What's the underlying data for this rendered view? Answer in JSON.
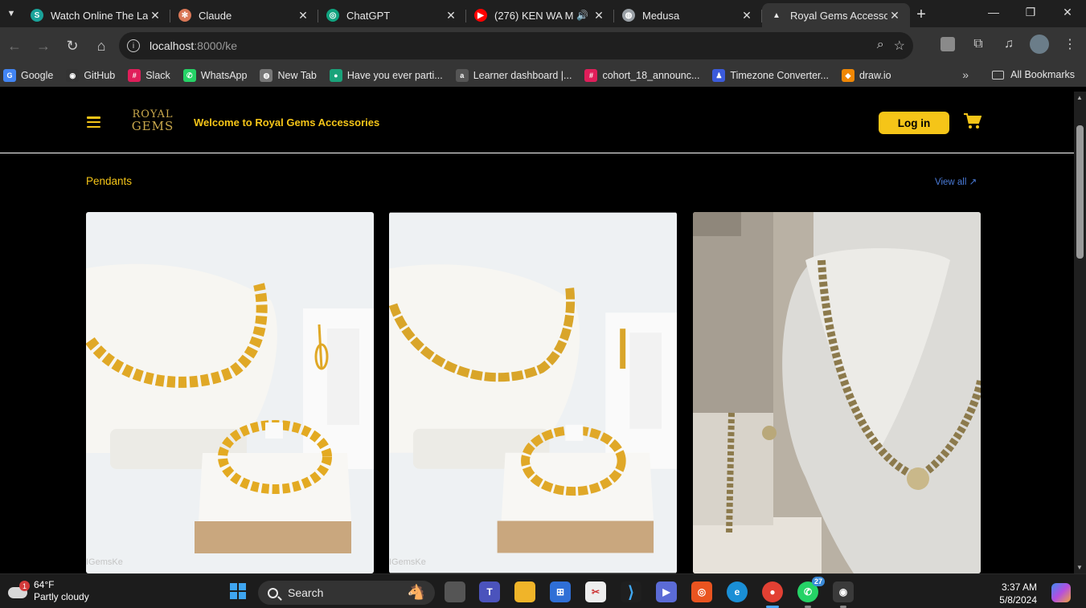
{
  "browser": {
    "tabs": [
      {
        "title": "Watch Online The Las",
        "favicon_color": "#1aa39a",
        "favicon_glyph": "S",
        "active": false
      },
      {
        "title": "Claude",
        "favicon_color": "#d97757",
        "favicon_glyph": "✻",
        "active": false
      },
      {
        "title": "ChatGPT",
        "favicon_color": "#10a37f",
        "favicon_glyph": "◎",
        "active": false
      },
      {
        "title": "(276) KEN WA M",
        "favicon_color": "#ff0000",
        "favicon_glyph": "▶",
        "active": false,
        "audio": true
      },
      {
        "title": "Medusa",
        "favicon_color": "#9aa0a6",
        "favicon_glyph": "◍",
        "active": false
      },
      {
        "title": "Royal Gems Accesso",
        "favicon_color": "#e8e8e8",
        "favicon_glyph": "▲",
        "active": true
      }
    ],
    "url_host": "localhost",
    "url_path": ":8000/ke",
    "bookmarks": [
      {
        "label": "Google",
        "icon_color": "#4285f4",
        "glyph": "G"
      },
      {
        "label": "GitHub",
        "icon_color": "#333333",
        "glyph": "◉"
      },
      {
        "label": "Slack",
        "icon_color": "#e01e5a",
        "glyph": "#"
      },
      {
        "label": "WhatsApp",
        "icon_color": "#25d366",
        "glyph": "✆"
      },
      {
        "label": "New Tab",
        "icon_color": "#777777",
        "glyph": "◍"
      },
      {
        "label": "Have you ever parti...",
        "icon_color": "#1aa37a",
        "glyph": "●"
      },
      {
        "label": "Learner dashboard |...",
        "icon_color": "#555555",
        "glyph": "a"
      },
      {
        "label": "cohort_18_announc...",
        "icon_color": "#e01e5a",
        "glyph": "#"
      },
      {
        "label": "Timezone Converter...",
        "icon_color": "#3b5bdb",
        "glyph": "♟"
      },
      {
        "label": "draw.io",
        "icon_color": "#f08705",
        "glyph": "◆"
      }
    ],
    "all_bookmarks": "All Bookmarks"
  },
  "site": {
    "logo_line1": "ROYAL",
    "logo_line2": "GEMS",
    "welcome": "Welcome to Royal Gems Accessories",
    "login_label": "Log in",
    "accent": "#f5c518"
  },
  "section": {
    "title": "Pendants",
    "view_all": "View all ↗",
    "products": [
      {
        "watermark": "IGemsKe"
      },
      {
        "watermark": "IGemsKe"
      },
      {
        "watermark": ""
      }
    ]
  },
  "taskbar": {
    "weather_badge": "1",
    "temperature": "64°F",
    "condition": "Partly cloudy",
    "search_label": "Search",
    "whatsapp_count": "27",
    "time": "3:37 AM",
    "date": "5/8/2024"
  }
}
